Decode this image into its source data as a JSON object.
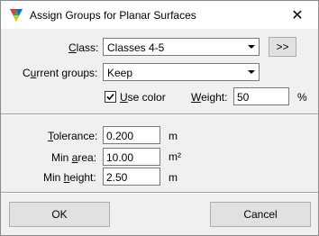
{
  "window": {
    "title": "Assign Groups for Planar Surfaces",
    "close_glyph": "✕"
  },
  "form": {
    "class_label_key": "C",
    "class_label_rest": "lass:",
    "class_value": "Classes 4-5",
    "more_button": ">>",
    "current_groups_label_pre": "C",
    "current_groups_label_key": "u",
    "current_groups_label_rest": "rrent groups:",
    "current_groups_value": "Keep",
    "use_color_checked": true,
    "use_color_key": "U",
    "use_color_rest": "se color",
    "weight_key": "W",
    "weight_rest": "eight:",
    "weight_value": "50",
    "weight_unit": "%",
    "tolerance_key": "T",
    "tolerance_rest": "olerance:",
    "tolerance_value": "0.200",
    "tolerance_unit": "m",
    "min_area_pre": "Min ",
    "min_area_key": "a",
    "min_area_rest": "rea:",
    "min_area_value": "10.00",
    "min_area_unit": "m²",
    "min_height_pre": "Min ",
    "min_height_key": "h",
    "min_height_rest": "eight:",
    "min_height_value": "2.50",
    "min_height_unit": "m"
  },
  "buttons": {
    "ok": "OK",
    "cancel": "Cancel"
  }
}
